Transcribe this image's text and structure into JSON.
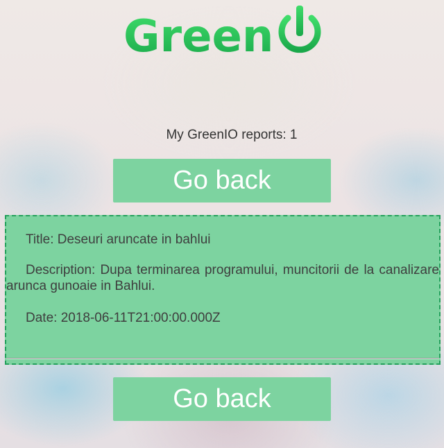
{
  "logo": {
    "text": "Green",
    "icon": "power-icon",
    "color": "#2bc253"
  },
  "reports": {
    "count_text": "My GreenIO reports: 1"
  },
  "buttons": {
    "go_back_top": "Go back",
    "go_back_bottom": "Go back"
  },
  "report": {
    "title": "Title: Deseuri aruncate in bahlui",
    "description": "Description: Dupa terminarea programului, muncitorii de la canalizare arunca gunoaie in Bahlui.",
    "date": "Date: 2018-06-11T21:00:00.000Z"
  },
  "colors": {
    "button_bg": "#7dd3a0",
    "card_bg": "#7dd3a0",
    "card_border": "#23a05b"
  }
}
